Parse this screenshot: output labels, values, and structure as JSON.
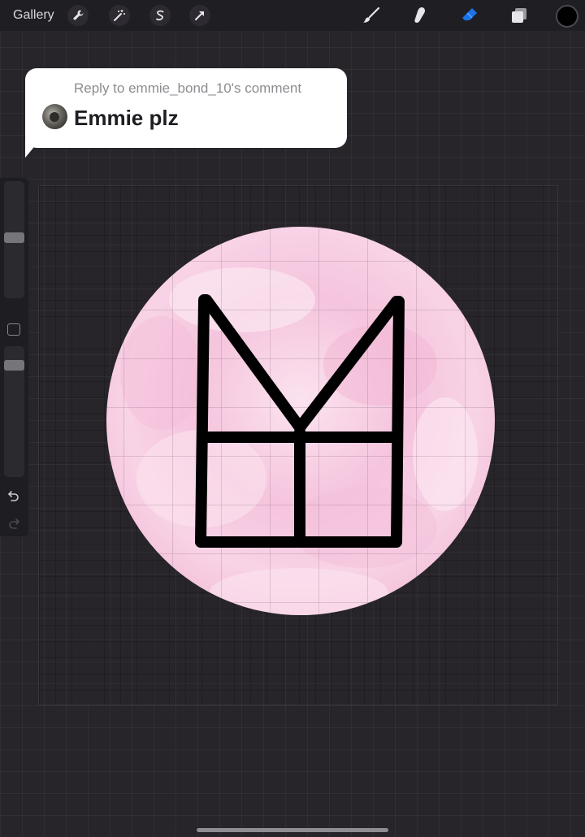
{
  "toolbar": {
    "gallery_label": "Gallery",
    "left_tools": [
      "wrench-icon",
      "magic-wand-icon",
      "selection-icon",
      "transform-arrow-icon"
    ],
    "right_tools": [
      "brush-icon",
      "smudge-icon",
      "eraser-icon",
      "layers-icon"
    ],
    "active_tool": "eraser-icon",
    "accent_color": "#1a73e8",
    "current_color": "#000000"
  },
  "reply": {
    "reply_to": "Reply to emmie_bond_10's comment",
    "text": "Emmie plz"
  },
  "sidebar": {
    "brush_size_level": 0.47,
    "opacity_level": 0.66,
    "icons": [
      "modify-icon",
      "undo-icon",
      "redo-icon"
    ]
  },
  "artwork": {
    "circle_fill": "#f5c8e0",
    "stroke_color": "#000000",
    "description_shapes": [
      "pink-watercolor-circle",
      "monogram-lines"
    ]
  }
}
